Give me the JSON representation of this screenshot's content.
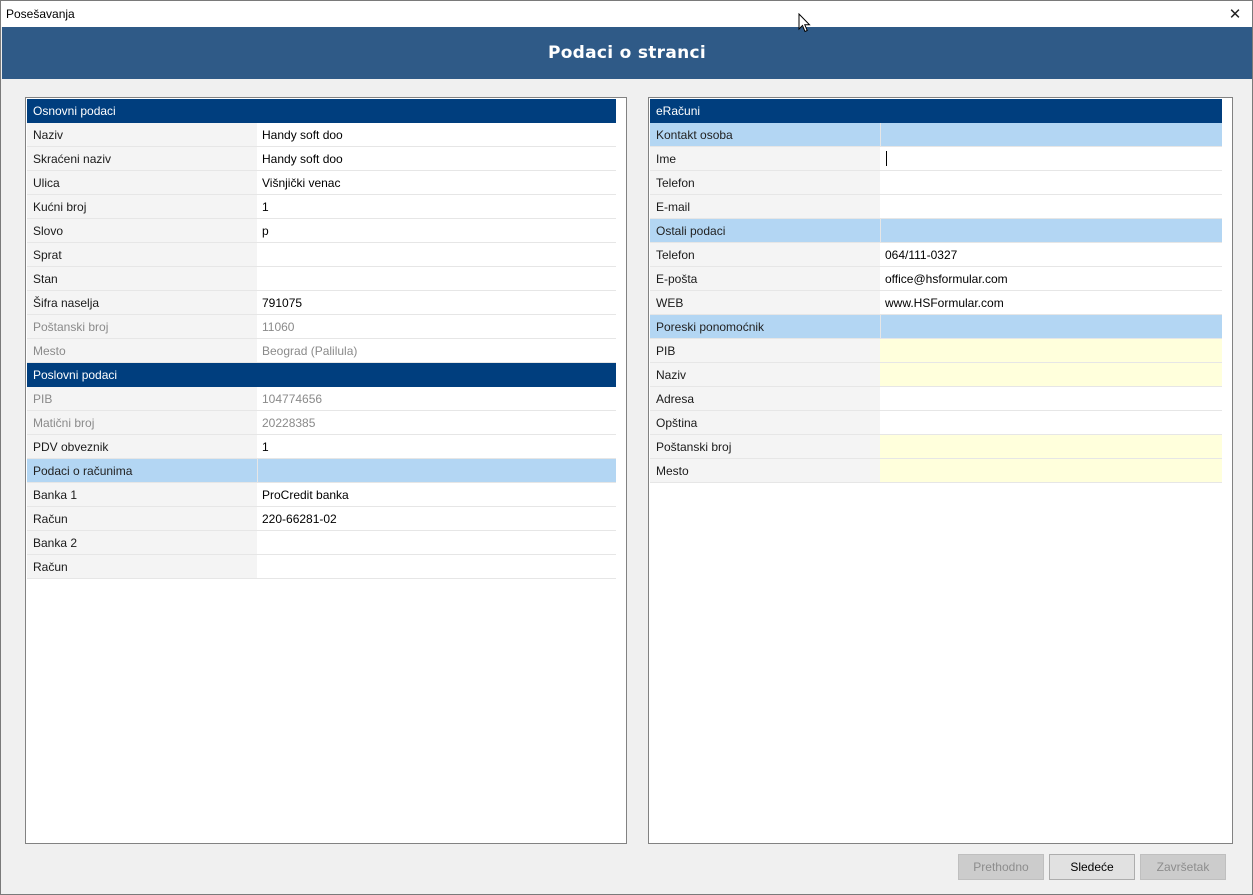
{
  "window": {
    "title": "Posešavanja",
    "close_glyph": "✕"
  },
  "header": {
    "title": "Podaci o stranci"
  },
  "left": {
    "osnovni": {
      "title": "Osnovni podaci",
      "rows": [
        {
          "label": "Naziv",
          "value": "Handy soft doo"
        },
        {
          "label": "Skraćeni naziv",
          "value": "Handy soft doo"
        },
        {
          "label": "Ulica",
          "value": "Višnjički venac"
        },
        {
          "label": "Kućni broj",
          "value": "1"
        },
        {
          "label": "Slovo",
          "value": "p"
        },
        {
          "label": "Sprat",
          "value": ""
        },
        {
          "label": "Stan",
          "value": ""
        },
        {
          "label": "Šifra naselja",
          "value": "791075"
        },
        {
          "label": "Poštanski broj",
          "value": "11060"
        },
        {
          "label": "Mesto",
          "value": "Beograd (Palilula)"
        }
      ]
    },
    "poslovni": {
      "title": "Poslovni podaci",
      "rows": [
        {
          "label": "PIB",
          "value": "104774656"
        },
        {
          "label": "Matični broj",
          "value": "20228385"
        },
        {
          "label": "PDV obveznik",
          "value": "1"
        }
      ]
    },
    "racuni": {
      "title": "Podaci o računima",
      "rows": [
        {
          "label": "Banka 1",
          "value": "ProCredit banka"
        },
        {
          "label": "Račun",
          "value": "220-66281-02"
        },
        {
          "label": "Banka 2",
          "value": ""
        },
        {
          "label": "Račun",
          "value": ""
        }
      ]
    }
  },
  "right": {
    "title": "eRačuni",
    "kontakt": {
      "title": "Kontakt osoba",
      "rows": [
        {
          "label": "Ime",
          "value": ""
        },
        {
          "label": "Telefon",
          "value": ""
        },
        {
          "label": "E-mail",
          "value": ""
        }
      ]
    },
    "ostali": {
      "title": "Ostali podaci",
      "rows": [
        {
          "label": "Telefon",
          "value": "064/111-0327"
        },
        {
          "label": "E-pošta",
          "value": "office@hsformular.com"
        },
        {
          "label": "WEB",
          "value": "www.HSFormular.com"
        }
      ]
    },
    "poreski": {
      "title": "Poreski ponomoćnik",
      "rows": [
        {
          "label": "PIB",
          "value": ""
        },
        {
          "label": "Naziv",
          "value": ""
        },
        {
          "label": "Adresa",
          "value": ""
        },
        {
          "label": "Opština",
          "value": ""
        },
        {
          "label": "Poštanski broj",
          "value": ""
        },
        {
          "label": "Mesto",
          "value": ""
        }
      ]
    }
  },
  "buttons": {
    "prev": "Prethodno",
    "next": "Sledeće",
    "finish": "Završetak"
  }
}
